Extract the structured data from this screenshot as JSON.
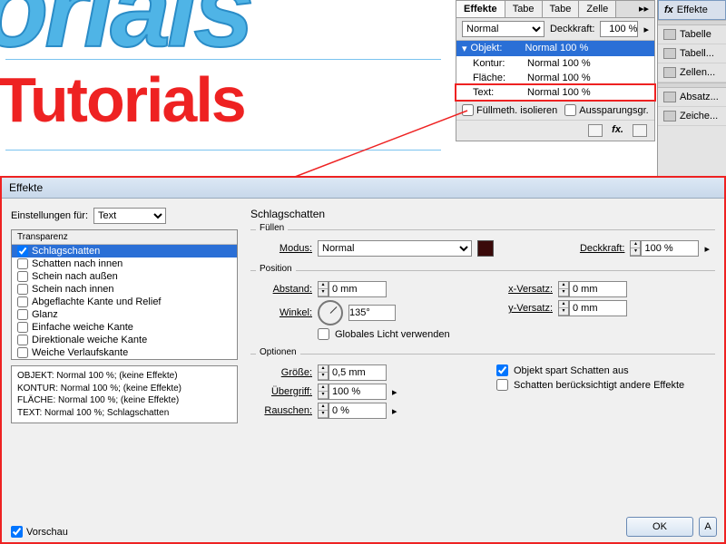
{
  "canvas": {
    "blue": "orials",
    "red": "-Tutorials"
  },
  "panel": {
    "tabs": [
      "Effekte",
      "Tabe",
      "Tabe",
      "Zelle"
    ],
    "blend": "Normal",
    "opacity_label": "Deckkraft:",
    "opacity": "100 %",
    "rows": [
      {
        "k": "Objekt:",
        "v": "Normal 100 %"
      },
      {
        "k": "Kontur:",
        "v": "Normal 100 %"
      },
      {
        "k": "Fläche:",
        "v": "Normal 100 %"
      },
      {
        "k": "Text:",
        "v": "Normal 100 %"
      }
    ],
    "iso": "Füllmeth. isolieren",
    "knock": "Aussparungsgr."
  },
  "rightbar": {
    "items": [
      "Effekte",
      "Tabelle",
      "Tabell...",
      "Zellen...",
      "Absatz...",
      "Zeiche..."
    ]
  },
  "dialog": {
    "title": "Effekte",
    "settings_for": "Einstellungen für:",
    "settings_value": "Text",
    "list_header": "Transparenz",
    "items": [
      {
        "label": "Schlagschatten",
        "checked": true,
        "sel": true
      },
      {
        "label": "Schatten nach innen"
      },
      {
        "label": "Schein nach außen"
      },
      {
        "label": "Schein nach innen"
      },
      {
        "label": "Abgeflachte Kante und Relief"
      },
      {
        "label": "Glanz"
      },
      {
        "label": "Einfache weiche Kante"
      },
      {
        "label": "Direktionale weiche Kante"
      },
      {
        "label": "Weiche Verlaufskante"
      }
    ],
    "summary": [
      "OBJEKT: Normal 100 %; (keine Effekte)",
      "KONTUR: Normal 100 %; (keine Effekte)",
      "FLÄCHE: Normal 100 %; (keine Effekte)",
      "TEXT: Normal 100 %; Schlagschatten"
    ],
    "preview": "Vorschau",
    "heading": "Schlagschatten",
    "fill": {
      "title": "Füllen",
      "mode": "Modus:",
      "mode_v": "Normal",
      "op": "Deckkraft:",
      "op_v": "100 %"
    },
    "pos": {
      "title": "Position",
      "dist": "Abstand:",
      "dist_v": "0 mm",
      "angle": "Winkel:",
      "angle_v": "135°",
      "global": "Globales Licht verwenden",
      "xo": "x-Versatz:",
      "xo_v": "0 mm",
      "yo": "y-Versatz:",
      "yo_v": "0 mm"
    },
    "opt": {
      "title": "Optionen",
      "size": "Größe:",
      "size_v": "0,5 mm",
      "spread": "Übergriff:",
      "spread_v": "100 %",
      "noise": "Rauschen:",
      "noise_v": "0 %",
      "knock": "Objekt spart Schatten aus",
      "other": "Schatten berücksichtigt andere Effekte"
    },
    "ok": "OK",
    "cancel": "A"
  }
}
